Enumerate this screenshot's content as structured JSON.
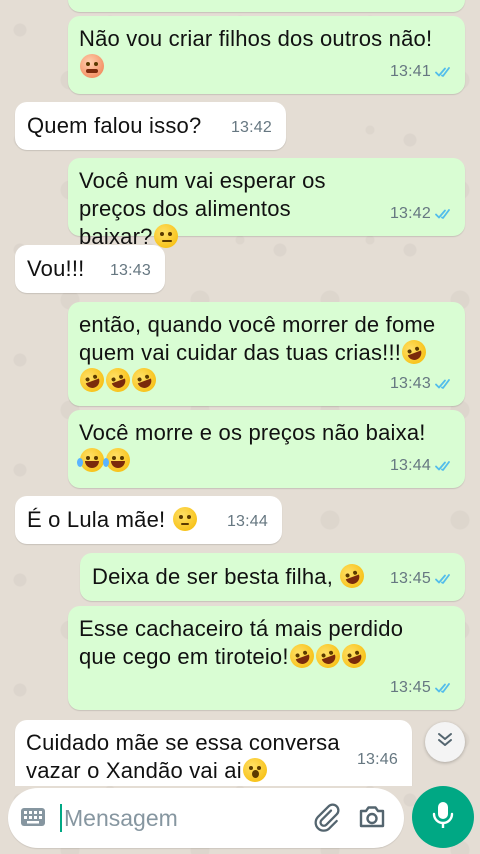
{
  "messages": [
    {
      "dir": "out",
      "text": "",
      "time": ""
    },
    {
      "dir": "out",
      "text": "Não vou criar filhos dos outros não!",
      "time": "13:41"
    },
    {
      "dir": "in",
      "text": "Quem falou isso?",
      "time": "13:42"
    },
    {
      "dir": "out",
      "text": "Você num vai esperar os preços dos alimentos baixar?",
      "time": "13:42"
    },
    {
      "dir": "in",
      "text": "Vou!!!",
      "time": "13:43"
    },
    {
      "dir": "out",
      "text": "então, quando você morrer de fome quem vai cuidar das tuas crias!!!",
      "time": "13:43"
    },
    {
      "dir": "out",
      "text": "Você morre e os preços não baixa!",
      "time": "13:44"
    },
    {
      "dir": "in",
      "text": "É o Lula mãe!",
      "time": "13:44"
    },
    {
      "dir": "out",
      "text": "Deixa de ser besta filha,",
      "time": "13:45"
    },
    {
      "dir": "out",
      "text": "Esse cachaceiro tá mais perdido que cego em tiroteio!",
      "time": "13:45"
    },
    {
      "dir": "in",
      "text": "Cuidado mãe se essa conversa vazar o Xandão vai ai",
      "time": "13:46"
    }
  ],
  "emojis": {
    "m1": "steam-from-nose-angry-emoji",
    "m3": "raised-eyebrow-emoji",
    "m5": "rolling-on-floor-laughing-emoji",
    "m6": "tears-of-joy-emoji",
    "m7": "pensive-emoji",
    "m8": "rolling-on-floor-laughing-emoji",
    "m9": "rolling-on-floor-laughing-emoji",
    "m10": "hushed-face-emoji"
  },
  "composer": {
    "placeholder": "Mensagem"
  },
  "icons": {
    "keyboard": "keyboard-icon",
    "attach": "paperclip-icon",
    "camera": "camera-icon",
    "mic": "microphone-icon",
    "scroll_down": "double-chevron-down-icon",
    "read": "double-check-icon"
  },
  "colors": {
    "outgoing_bubble": "#d9fdd3",
    "incoming_bubble": "#ffffff",
    "read_ticks": "#53bdeb",
    "accent": "#00a884",
    "chat_background": "#e4ddd4"
  }
}
